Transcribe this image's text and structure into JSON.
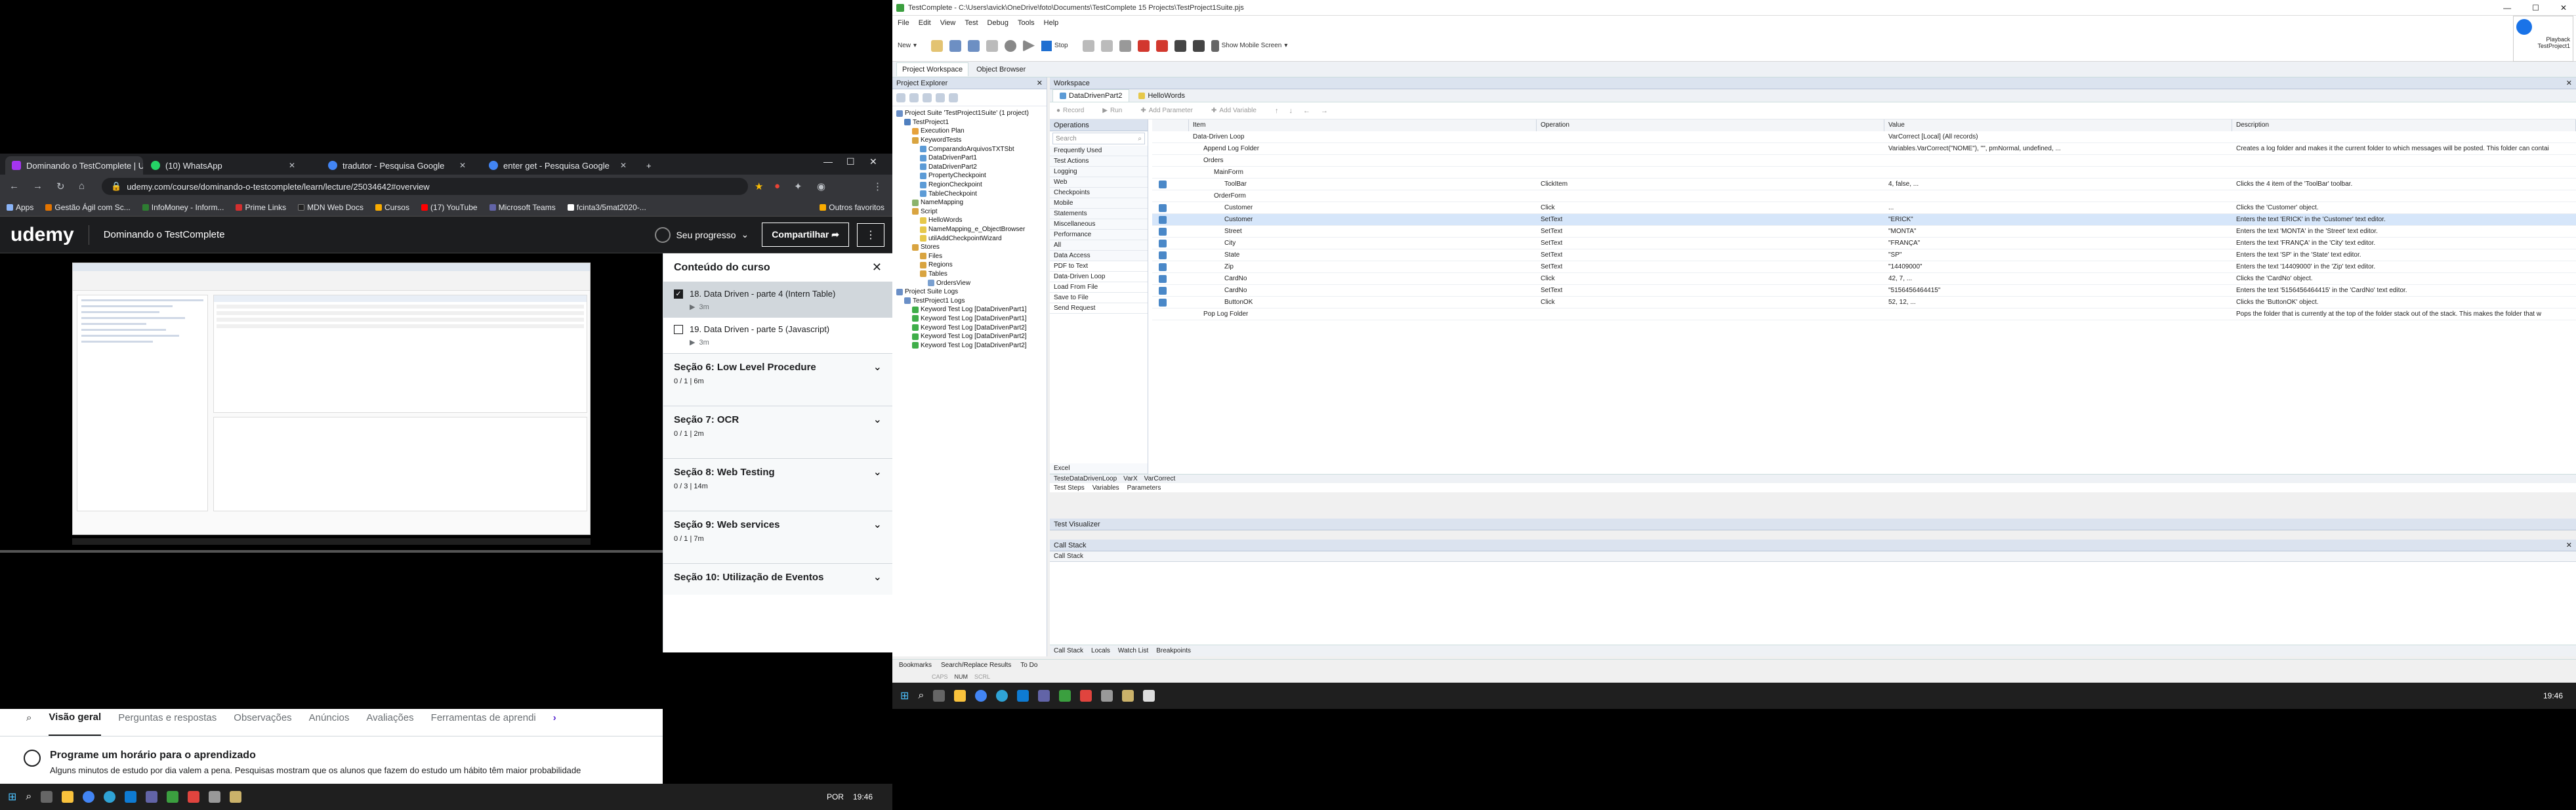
{
  "browser": {
    "tabs": [
      {
        "title": "Dominando o TestComplete | U...",
        "color": "#a435f0"
      },
      {
        "title": "(10) WhatsApp",
        "color": "#25d366"
      },
      {
        "title": "tradutor - Pesquisa Google",
        "color": "#4285f4"
      },
      {
        "title": "enter get - Pesquisa Google",
        "color": "#4285f4"
      }
    ],
    "new_tab": "+",
    "url": "udemy.com/course/dominando-o-testcomplete/learn/lecture/25034642#overview",
    "bookmarks": [
      "Apps",
      "Gestão Ágil com Sc...",
      "InfoMoney - Inform...",
      "Prime Links",
      "MDN Web Docs",
      "Cursos",
      "(17) YouTube",
      "Microsoft Teams",
      "fcinta3/5mat2020-..."
    ],
    "other_bookmarks": "Outros favoritos"
  },
  "udemy": {
    "logo": "udemy",
    "course_title": "Dominando o TestComplete",
    "progress_label": "Seu progresso",
    "share_label": "Compartilhar",
    "panel_title": "Conteúdo do curso",
    "lectures": [
      {
        "title": "18. Data Driven - parte 4 (Intern Table)",
        "duration": "3m",
        "checked": true,
        "active": true
      },
      {
        "title": "19. Data Driven - parte 5 (Javascript)",
        "duration": "3m",
        "checked": false,
        "active": false
      }
    ],
    "sections": [
      {
        "title": "Seção 6: Low Level Procedure",
        "meta": "0 / 1 | 6m"
      },
      {
        "title": "Seção 7: OCR",
        "meta": "0 / 1 | 2m"
      },
      {
        "title": "Seção 8: Web Testing",
        "meta": "0 / 3 | 14m"
      },
      {
        "title": "Seção 9: Web services",
        "meta": "0 / 1 | 7m"
      },
      {
        "title": "Seção 10: Utilização de Eventos",
        "meta": ""
      }
    ],
    "nav_tabs": [
      "Visão geral",
      "Perguntas e respostas",
      "Observações",
      "Anúncios",
      "Avaliações",
      "Ferramentas de aprendi"
    ],
    "reminder_title": "Programe um horário para o aprendizado",
    "reminder_text": "Alguns minutos de estudo por dia valem a pena. Pesquisas mostram que os alunos que fazem do estudo um hábito têm maior probabilidade"
  },
  "taskbar_left": {
    "lang": "POR",
    "time": "19:46"
  },
  "testcomplete": {
    "title": "TestComplete - C:\\Users\\avick\\OneDrive\\foto\\Documents\\TestComplete 15 Projects\\TestProject1Suite.pjs",
    "menu": [
      "File",
      "Edit",
      "View",
      "Test",
      "Debug",
      "Tools",
      "Help"
    ],
    "toolbar": {
      "new": "New",
      "stop": "Stop",
      "mobile": "Show Mobile Screen"
    },
    "ws_tabs": [
      "Project Workspace",
      "Object Browser"
    ],
    "explorer_title": "Project Explorer",
    "tree": [
      {
        "label": "Project Suite 'TestProject1Suite' (1 project)",
        "indent": 0,
        "color": "#6a8fc7"
      },
      {
        "label": "TestProject1",
        "indent": 1,
        "color": "#4f7fbf"
      },
      {
        "label": "Execution Plan",
        "indent": 2,
        "color": "#e6a23c"
      },
      {
        "label": "KeywordTests",
        "indent": 2,
        "color": "#d9a440"
      },
      {
        "label": "ComparandoArquivosTXTSbt",
        "indent": 3,
        "color": "#5c9bd6"
      },
      {
        "label": "DataDrivenPart1",
        "indent": 3,
        "color": "#5c9bd6"
      },
      {
        "label": "DataDrivenPart2",
        "indent": 3,
        "color": "#5c9bd6"
      },
      {
        "label": "PropertyCheckpoint",
        "indent": 3,
        "color": "#5c9bd6"
      },
      {
        "label": "RegionCheckpoint",
        "indent": 3,
        "color": "#5c9bd6"
      },
      {
        "label": "TableCheckpoint",
        "indent": 3,
        "color": "#5c9bd6"
      },
      {
        "label": "NameMapping",
        "indent": 2,
        "color": "#8bb36b"
      },
      {
        "label": "Script",
        "indent": 2,
        "color": "#d9a440"
      },
      {
        "label": "HelloWords",
        "indent": 3,
        "color": "#e6c84a"
      },
      {
        "label": "NameMapping_e_ObjectBrowser",
        "indent": 3,
        "color": "#e6c84a"
      },
      {
        "label": "utilAddCheckpointWizard",
        "indent": 3,
        "color": "#e6c84a"
      },
      {
        "label": "Stores",
        "indent": 2,
        "color": "#d9a440"
      },
      {
        "label": "Files",
        "indent": 3,
        "color": "#d9a440"
      },
      {
        "label": "Regions",
        "indent": 3,
        "color": "#d9a440"
      },
      {
        "label": "Tables",
        "indent": 3,
        "color": "#d9a440"
      },
      {
        "label": "OrdersView",
        "indent": 4,
        "color": "#7aa0d0"
      },
      {
        "label": "Project Suite Logs",
        "indent": 0,
        "color": "#6a8fc7"
      },
      {
        "label": "TestProject1 Logs",
        "indent": 1,
        "color": "#6a8fc7"
      },
      {
        "label": "Keyword Test Log [DataDrivenPart1]",
        "indent": 2,
        "color": "#3fae49"
      },
      {
        "label": "Keyword Test Log [DataDrivenPart1]",
        "indent": 2,
        "color": "#3fae49"
      },
      {
        "label": "Keyword Test Log [DataDrivenPart2]",
        "indent": 2,
        "color": "#3fae49"
      },
      {
        "label": "Keyword Test Log [DataDrivenPart2]",
        "indent": 2,
        "color": "#3fae49"
      },
      {
        "label": "Keyword Test Log [DataDrivenPart2]",
        "indent": 2,
        "color": "#3fae49"
      }
    ],
    "workspace_title": "Workspace",
    "editor_tabs": [
      "DataDrivenPart2",
      "HelloWords"
    ],
    "editor_toolbar": [
      "Record",
      "Run",
      "Add Parameter",
      "Add Variable"
    ],
    "operations_title": "Operations",
    "operations_search": "Search",
    "operations": [
      "Frequently Used",
      "Test Actions",
      "Logging",
      "Web",
      "Checkpoints",
      "Mobile",
      "Statements",
      "Miscellaneous",
      "Performance",
      "All",
      "Data Access",
      "PDF to Text",
      "Data-Driven Loop",
      "Load From File",
      "Save to File",
      "Send Request"
    ],
    "operations_footer": "Excel",
    "grid_headers": [
      "Item",
      "Operation",
      "Value",
      "Description"
    ],
    "rows": [
      {
        "item": "Data-Driven Loop",
        "op": "",
        "value": "VarCorrect [Local] (All records)",
        "desc": "",
        "indent": 0,
        "sel": false
      },
      {
        "item": "Append Log Folder",
        "op": "",
        "value": "Variables.VarCorrect(\"NOME\"), \"\", pmNormal, undefined, ...",
        "desc": "Creates a log folder and makes it the current folder to which messages will be posted. This folder can contai",
        "indent": 1,
        "sel": false
      },
      {
        "item": "Orders",
        "op": "",
        "value": "",
        "desc": "",
        "indent": 1,
        "sel": false
      },
      {
        "item": "MainForm",
        "op": "",
        "value": "",
        "desc": "",
        "indent": 2,
        "sel": false
      },
      {
        "item": "ToolBar",
        "op": "ClickItem",
        "value": "4, false, ...",
        "desc": "Clicks the 4 item of the 'ToolBar' toolbar.",
        "indent": 3,
        "sel": false
      },
      {
        "item": "OrderForm",
        "op": "",
        "value": "",
        "desc": "",
        "indent": 2,
        "sel": false
      },
      {
        "item": "Customer",
        "op": "Click",
        "value": "...",
        "desc": "Clicks the 'Customer' object.",
        "indent": 3,
        "sel": false
      },
      {
        "item": "Customer",
        "op": "SetText",
        "value": "\"ERICK\"",
        "desc": "Enters the text 'ERICK' in the 'Customer' text editor.",
        "indent": 3,
        "sel": true
      },
      {
        "item": "Street",
        "op": "SetText",
        "value": "\"MONTA\"",
        "desc": "Enters the text 'MONTA' in the 'Street' text editor.",
        "indent": 3,
        "sel": false
      },
      {
        "item": "City",
        "op": "SetText",
        "value": "\"FRANÇA\"",
        "desc": "Enters the text 'FRANÇA' in the 'City' text editor.",
        "indent": 3,
        "sel": false
      },
      {
        "item": "State",
        "op": "SetText",
        "value": "\"SP\"",
        "desc": "Enters the text 'SP' in the 'State' text editor.",
        "indent": 3,
        "sel": false
      },
      {
        "item": "Zip",
        "op": "SetText",
        "value": "\"14409000\"",
        "desc": "Enters the text '14409000' in the 'Zip' text editor.",
        "indent": 3,
        "sel": false
      },
      {
        "item": "CardNo",
        "op": "Click",
        "value": "42, 7, ...",
        "desc": "Clicks the 'CardNo' object.",
        "indent": 3,
        "sel": false
      },
      {
        "item": "CardNo",
        "op": "SetText",
        "value": "\"5156456464415\"",
        "desc": "Enters the text '5156456464415' in the 'CardNo' text editor.",
        "indent": 3,
        "sel": false
      },
      {
        "item": "ButtonOK",
        "op": "Click",
        "value": "52, 12, ...",
        "desc": "Clicks the 'ButtonOK' object.",
        "indent": 3,
        "sel": false
      },
      {
        "item": "Pop Log Folder",
        "op": "",
        "value": "",
        "desc": "Pops the folder that is currently at the top of the folder stack out of the stack. This makes the folder that w",
        "indent": 1,
        "sel": false
      }
    ],
    "bottom_strip": [
      "TesteDataDrivenLoop",
      "VarX",
      "VarCorrect"
    ],
    "editor_bottom_tabs": [
      "Test Steps",
      "Variables",
      "Parameters"
    ],
    "test_visualizer": "Test Visualizer",
    "call_stack_title": "Call Stack",
    "call_stack_header": "Call Stack",
    "callstack_tabs": [
      "Call Stack",
      "Locals",
      "Watch List",
      "Breakpoints"
    ],
    "bottom_tabs": [
      "Bookmarks",
      "Search/Replace Results",
      "To Do"
    ],
    "status": [
      "CAPS",
      "NUM",
      "SCRL"
    ],
    "playback_label": "Playback",
    "playback_sub": "TestProject1",
    "taskbar_time": "19:46"
  }
}
